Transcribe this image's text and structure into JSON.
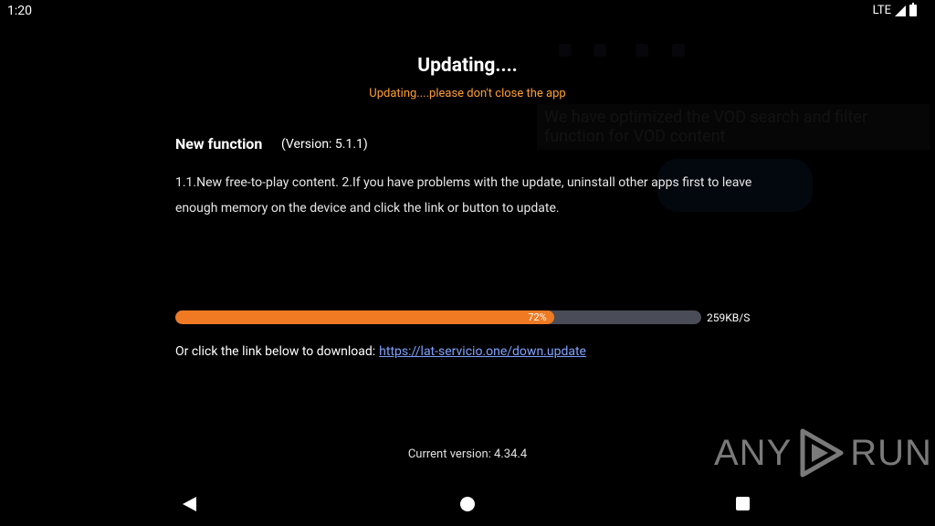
{
  "status_bar": {
    "time": "1:20",
    "network": "LTE"
  },
  "background": {
    "tooltip_text": "We have optimized the VOD search and filter function for VOD content"
  },
  "dialog": {
    "title": "Updating....",
    "subtitle": "Updating....please don't close the app",
    "new_function_label": "New function",
    "version_label": "(Version: 5.1.1)",
    "description": "1.1.New free-to-play content. 2.If you have problems with the update, uninstall other apps first to leave enough memory on the device and click the link or button to update.",
    "progress": {
      "value": 0.72,
      "label": "72%",
      "speed": "259KB/S"
    },
    "link_prefix": "Or click the link below to download:",
    "link_url": "https://lat-servicio.one/down.update",
    "current_version": "Current version: 4.34.4"
  },
  "watermark": {
    "left": "ANY",
    "right": "RUN"
  },
  "colors": {
    "accent_orange": "#f07a23",
    "subtitle_orange": "#ff9f2e",
    "link_blue": "#7fa3ff",
    "track": "#4a4d57"
  },
  "icons": {
    "signal": "signal-icon",
    "battery": "battery-icon",
    "back": "back-icon",
    "home": "home-icon",
    "recents": "recents-icon"
  }
}
